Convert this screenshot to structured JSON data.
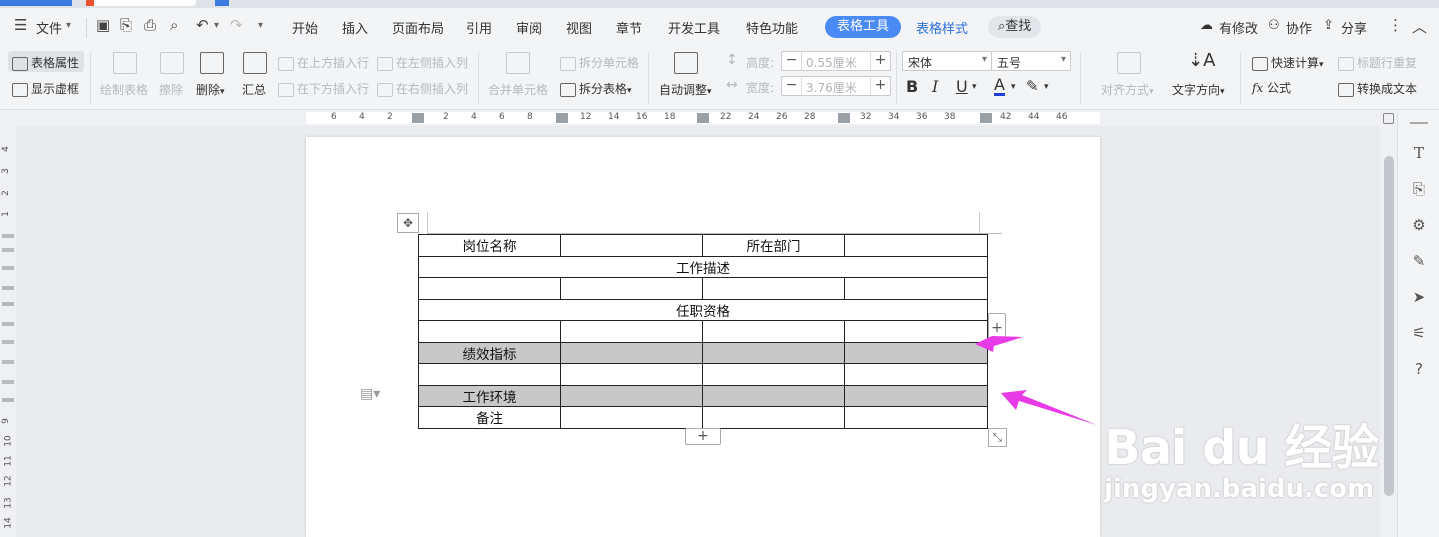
{
  "menu": {
    "file": "文件",
    "tabs": [
      "开始",
      "插入",
      "页面布局",
      "引用",
      "审阅",
      "视图",
      "章节",
      "开发工具",
      "特色功能"
    ],
    "table_tools": "表格工具",
    "table_style": "表格样式",
    "search": "查找",
    "right": {
      "modified": "有修改",
      "collab": "协作",
      "share": "分享"
    }
  },
  "ribbon": {
    "table_props": "表格属性",
    "show_grid": "显示虚框",
    "draw_table": "绘制表格",
    "erase": "擦除",
    "delete": "删除",
    "summary": "汇总",
    "insert_above": "在上方插入行",
    "insert_below": "在下方插入行",
    "insert_left": "在左侧插入列",
    "insert_right": "在右侧插入列",
    "merge": "合并单元格",
    "split_cell": "拆分单元格",
    "split_table": "拆分表格",
    "auto_fit": "自动调整",
    "height_label": "高度:",
    "height_value": "0.55厘米",
    "width_label": "宽度:",
    "width_value": "3.76厘米",
    "font_name": "宋体",
    "font_size": "五号",
    "bold": "B",
    "italic": "I",
    "underline": "U",
    "font_color": "A",
    "align": "对齐方式",
    "text_dir": "文字方向",
    "quick_calc": "快速计算",
    "header_repeat": "标题行重复",
    "formula": "公式",
    "to_text": "转换成文本"
  },
  "ruler": {
    "ticks": [
      "6",
      "4",
      "2",
      "2",
      "4",
      "6",
      "8",
      "12",
      "14",
      "16",
      "18",
      "22",
      "24",
      "26",
      "28",
      "32",
      "34",
      "36",
      "38",
      "42",
      "44",
      "46"
    ],
    "vticks": [
      "4",
      "3",
      "2",
      "1",
      "9",
      "10",
      "11",
      "12",
      "13",
      "14"
    ]
  },
  "table": {
    "rows": [
      {
        "cells": [
          "岗位名称",
          "",
          "所在部门",
          ""
        ],
        "shaded": false
      },
      {
        "cells": [
          "工作描述"
        ],
        "merged": true,
        "shaded": false
      },
      {
        "cells": [
          "",
          "",
          "",
          ""
        ],
        "shaded": false
      },
      {
        "cells": [
          "任职资格"
        ],
        "merged": true,
        "shaded": false
      },
      {
        "cells": [
          "",
          "",
          "",
          ""
        ],
        "shaded": false
      },
      {
        "cells": [
          "绩效指标",
          "",
          "",
          ""
        ],
        "shaded": true
      },
      {
        "cells": [
          "",
          "",
          "",
          ""
        ],
        "shaded": false
      },
      {
        "cells": [
          "工作环境",
          "",
          "",
          ""
        ],
        "shaded": true
      },
      {
        "cells": [
          "备注",
          "",
          "",
          ""
        ],
        "shaded": false
      }
    ]
  },
  "handles": {
    "add": "+",
    "move": "✥",
    "resize": "⤡"
  },
  "watermark": {
    "main": "Bai du 经验",
    "sub": "jingyan.baidu.com"
  },
  "colors": {
    "accent": "#4a8af4",
    "shade": "#c8c8c8",
    "arrow": "#e83ae6"
  }
}
